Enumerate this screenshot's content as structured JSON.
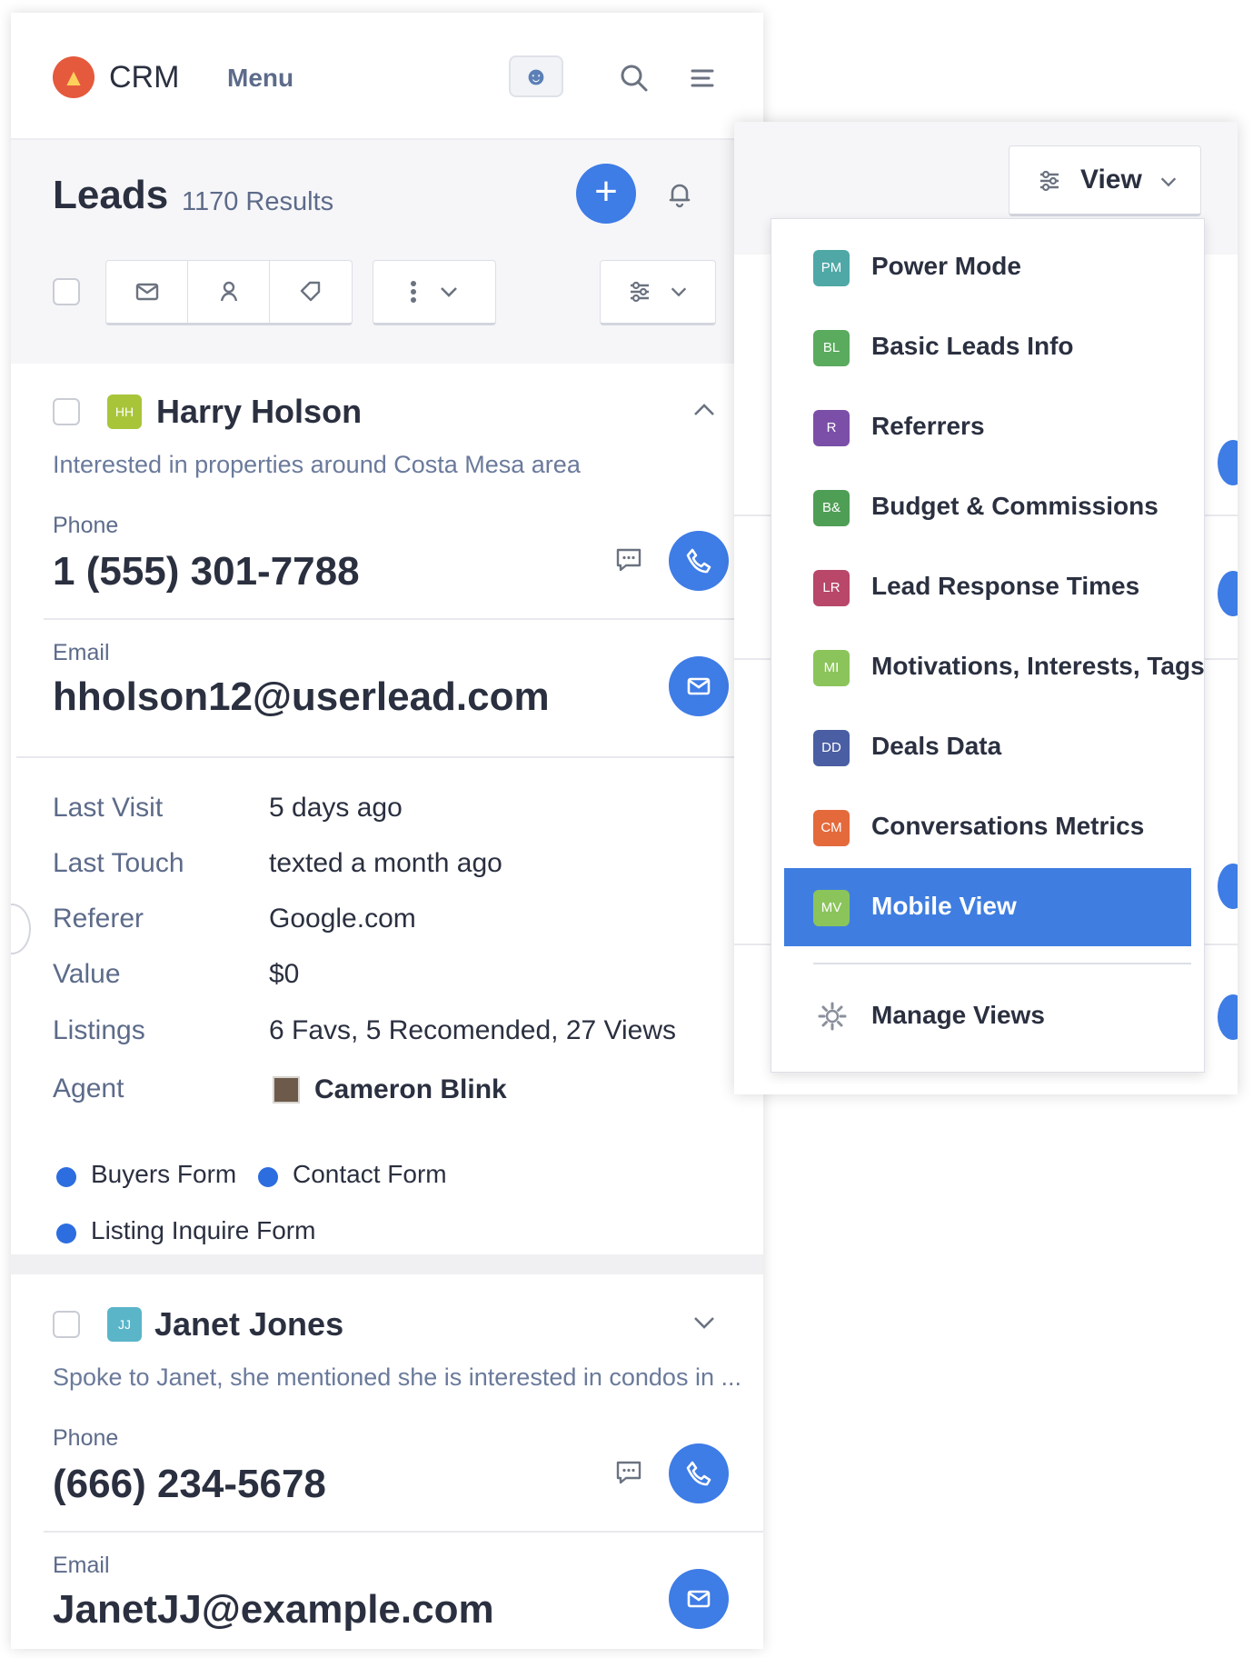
{
  "app": {
    "brand": "CRM",
    "menu_label": "Menu"
  },
  "leads": {
    "title": "Leads",
    "count": "1170 Results"
  },
  "lead1": {
    "initials": "HH",
    "name": "Harry Holson",
    "note": "Interested in properties around Costa Mesa area",
    "phone_label": "Phone",
    "phone": "1 (555) 301-7788",
    "email_label": "Email",
    "email": "hholson12@userlead.com",
    "details": [
      {
        "label": "Last Visit",
        "value": "5 days ago"
      },
      {
        "label": "Last Touch",
        "value": "texted a month ago"
      },
      {
        "label": "Referer",
        "value": "Google.com"
      },
      {
        "label": "Value",
        "value": "$0"
      },
      {
        "label": "Listings",
        "value": "6 Favs, 5 Recomended, 27 Views"
      },
      {
        "label": "Agent",
        "value": "Cameron Blink"
      }
    ],
    "forms": [
      "Buyers Form",
      "Contact Form",
      "Listing Inquire Form"
    ]
  },
  "lead2": {
    "initials": "JJ",
    "name": "Janet Jones",
    "note": "Spoke to Janet, she mentioned she is interested in condos in ...",
    "phone_label": "Phone",
    "phone": "(666) 234-5678",
    "email_label": "Email",
    "email": "JanetJJ@example.com"
  },
  "view_panel": {
    "button_label": "View",
    "items": [
      {
        "abbr": "PM",
        "label": "Power Mode",
        "color": "#4fa8a6"
      },
      {
        "abbr": "BL",
        "label": "Basic Leads Info",
        "color": "#5aab5e"
      },
      {
        "abbr": "R",
        "label": "Referrers",
        "color": "#7b4fa8"
      },
      {
        "abbr": "B&",
        "label": "Budget & Commissions",
        "color": "#4f9e55"
      },
      {
        "abbr": "LR",
        "label": "Lead Response Times",
        "color": "#b8476a"
      },
      {
        "abbr": "MI",
        "label": "Motivations, Interests, Tags",
        "color": "#8bc45a"
      },
      {
        "abbr": "DD",
        "label": "Deals Data",
        "color": "#4a5ea3"
      },
      {
        "abbr": "CM",
        "label": "Conversations Metrics",
        "color": "#e46a3c"
      },
      {
        "abbr": "MV",
        "label": "Mobile View",
        "color": "#8bc45a"
      }
    ],
    "active": "Mobile View",
    "manage_label": "Manage Views"
  },
  "colors": {
    "accent": "#3e7ce6",
    "active_item": "#3f7ee0",
    "badge_hh": "#a8c53a",
    "badge_jj": "#5bb5c9"
  },
  "icons": [
    "flame-icon",
    "robot-icon",
    "search-icon",
    "hamburger-icon",
    "plus-icon",
    "bell-icon",
    "mail-icon",
    "assign-icon",
    "tag-icon",
    "more-icon",
    "chevron-down-icon",
    "filter-icon",
    "chevron-up-icon",
    "chat-icon",
    "phone-icon",
    "gear-icon"
  ]
}
